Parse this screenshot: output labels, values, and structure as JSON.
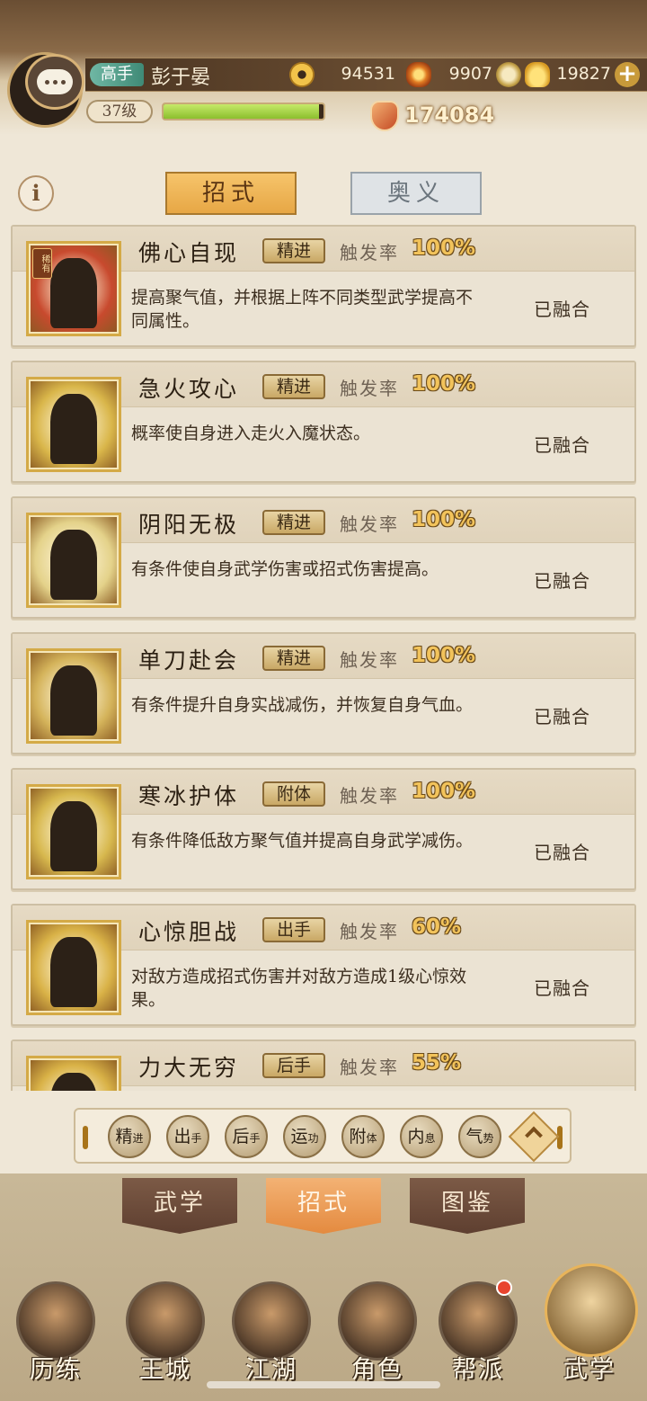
{
  "player": {
    "rank": "高手",
    "name": "彭于晏",
    "level": "37级",
    "exp_fraction": 0.97,
    "power": "174084"
  },
  "resources": [
    {
      "icon": "coin-icon",
      "value": "94531"
    },
    {
      "icon": "flame-icon",
      "value": "9907"
    },
    {
      "icon": "ingot-icon",
      "value": "19827"
    }
  ],
  "tabs": {
    "active": "招式",
    "inactive": "奥义"
  },
  "skills": [
    {
      "title": "佛心自现",
      "tag": "精进",
      "rate_label": "触发率",
      "rate": "100%",
      "desc": "提高聚气值，并根据上阵不同类型武学提高不同属性。",
      "status": "已融合",
      "badge": "稀有"
    },
    {
      "title": "急火攻心",
      "tag": "精进",
      "rate_label": "触发率",
      "rate": "100%",
      "desc": "概率使自身进入走火入魔状态。",
      "status": "已融合"
    },
    {
      "title": "阴阳无极",
      "tag": "精进",
      "rate_label": "触发率",
      "rate": "100%",
      "desc": "有条件使自身武学伤害或招式伤害提高。",
      "status": "已融合"
    },
    {
      "title": "单刀赴会",
      "tag": "精进",
      "rate_label": "触发率",
      "rate": "100%",
      "desc": "有条件提升自身实战减伤，并恢复自身气血。",
      "status": "已融合"
    },
    {
      "title": "寒冰护体",
      "tag": "附体",
      "rate_label": "触发率",
      "rate": "100%",
      "desc": "有条件降低敌方聚气值并提高自身武学减伤。",
      "status": "已融合"
    },
    {
      "title": "心惊胆战",
      "tag": "出手",
      "rate_label": "触发率",
      "rate": "60%",
      "desc": "对敌方造成招式伤害并对敌方造成1级心惊效果。",
      "status": "已融合"
    },
    {
      "title": "力大无穷",
      "tag": "后手",
      "rate_label": "触发率",
      "rate": "55%",
      "desc": "",
      "status": ""
    }
  ],
  "filters": [
    {
      "main": "精",
      "sub": "进"
    },
    {
      "main": "出",
      "sub": "手"
    },
    {
      "main": "后",
      "sub": "手"
    },
    {
      "main": "运",
      "sub": "功"
    },
    {
      "main": "附",
      "sub": "体"
    },
    {
      "main": "内",
      "sub": "息"
    },
    {
      "main": "气",
      "sub": "势"
    }
  ],
  "subtabs": [
    "武学",
    "招式",
    "图鉴"
  ],
  "nav": [
    "历练",
    "王城",
    "江湖",
    "角色",
    "帮派",
    "武学"
  ],
  "colors": {
    "accent": "#e7a745",
    "rate_gold": "#f2c35b",
    "notify_red": "#e8442e"
  }
}
